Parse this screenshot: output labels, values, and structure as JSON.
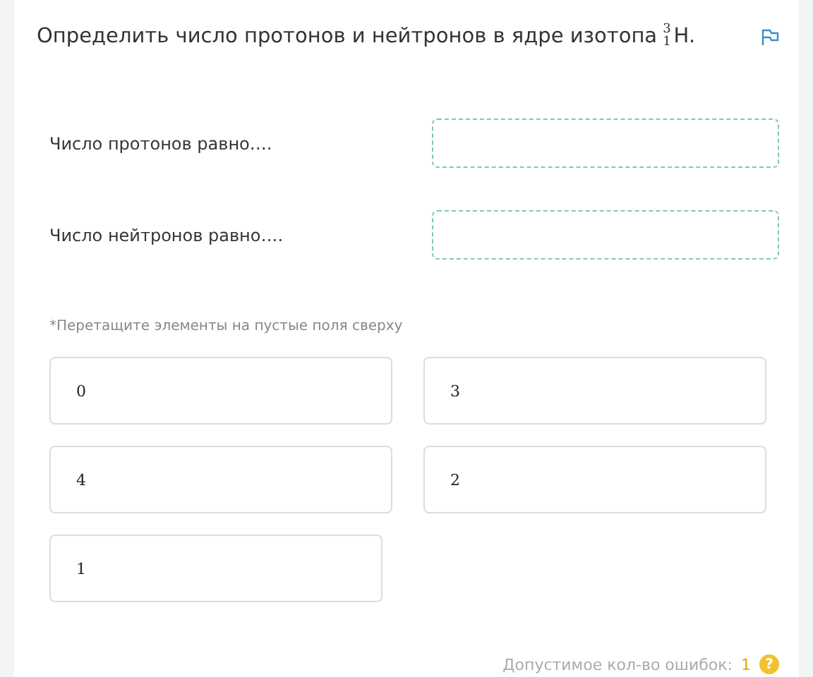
{
  "question": {
    "text": "Определить число протонов и нейтронов в ядре изотопа",
    "isotope": {
      "mass": "3",
      "atomic": "1",
      "symbol": "H."
    }
  },
  "slots": [
    {
      "label": "Число протонов равно…."
    },
    {
      "label": "Число нейтронов равно…."
    }
  ],
  "hint": "*Перетащите элементы на пустые поля сверху",
  "options": [
    "0",
    "3",
    "4",
    "2",
    "1"
  ],
  "footer": {
    "text": "Допустимое кол-во ошибок:",
    "count": "1",
    "help": "?"
  }
}
